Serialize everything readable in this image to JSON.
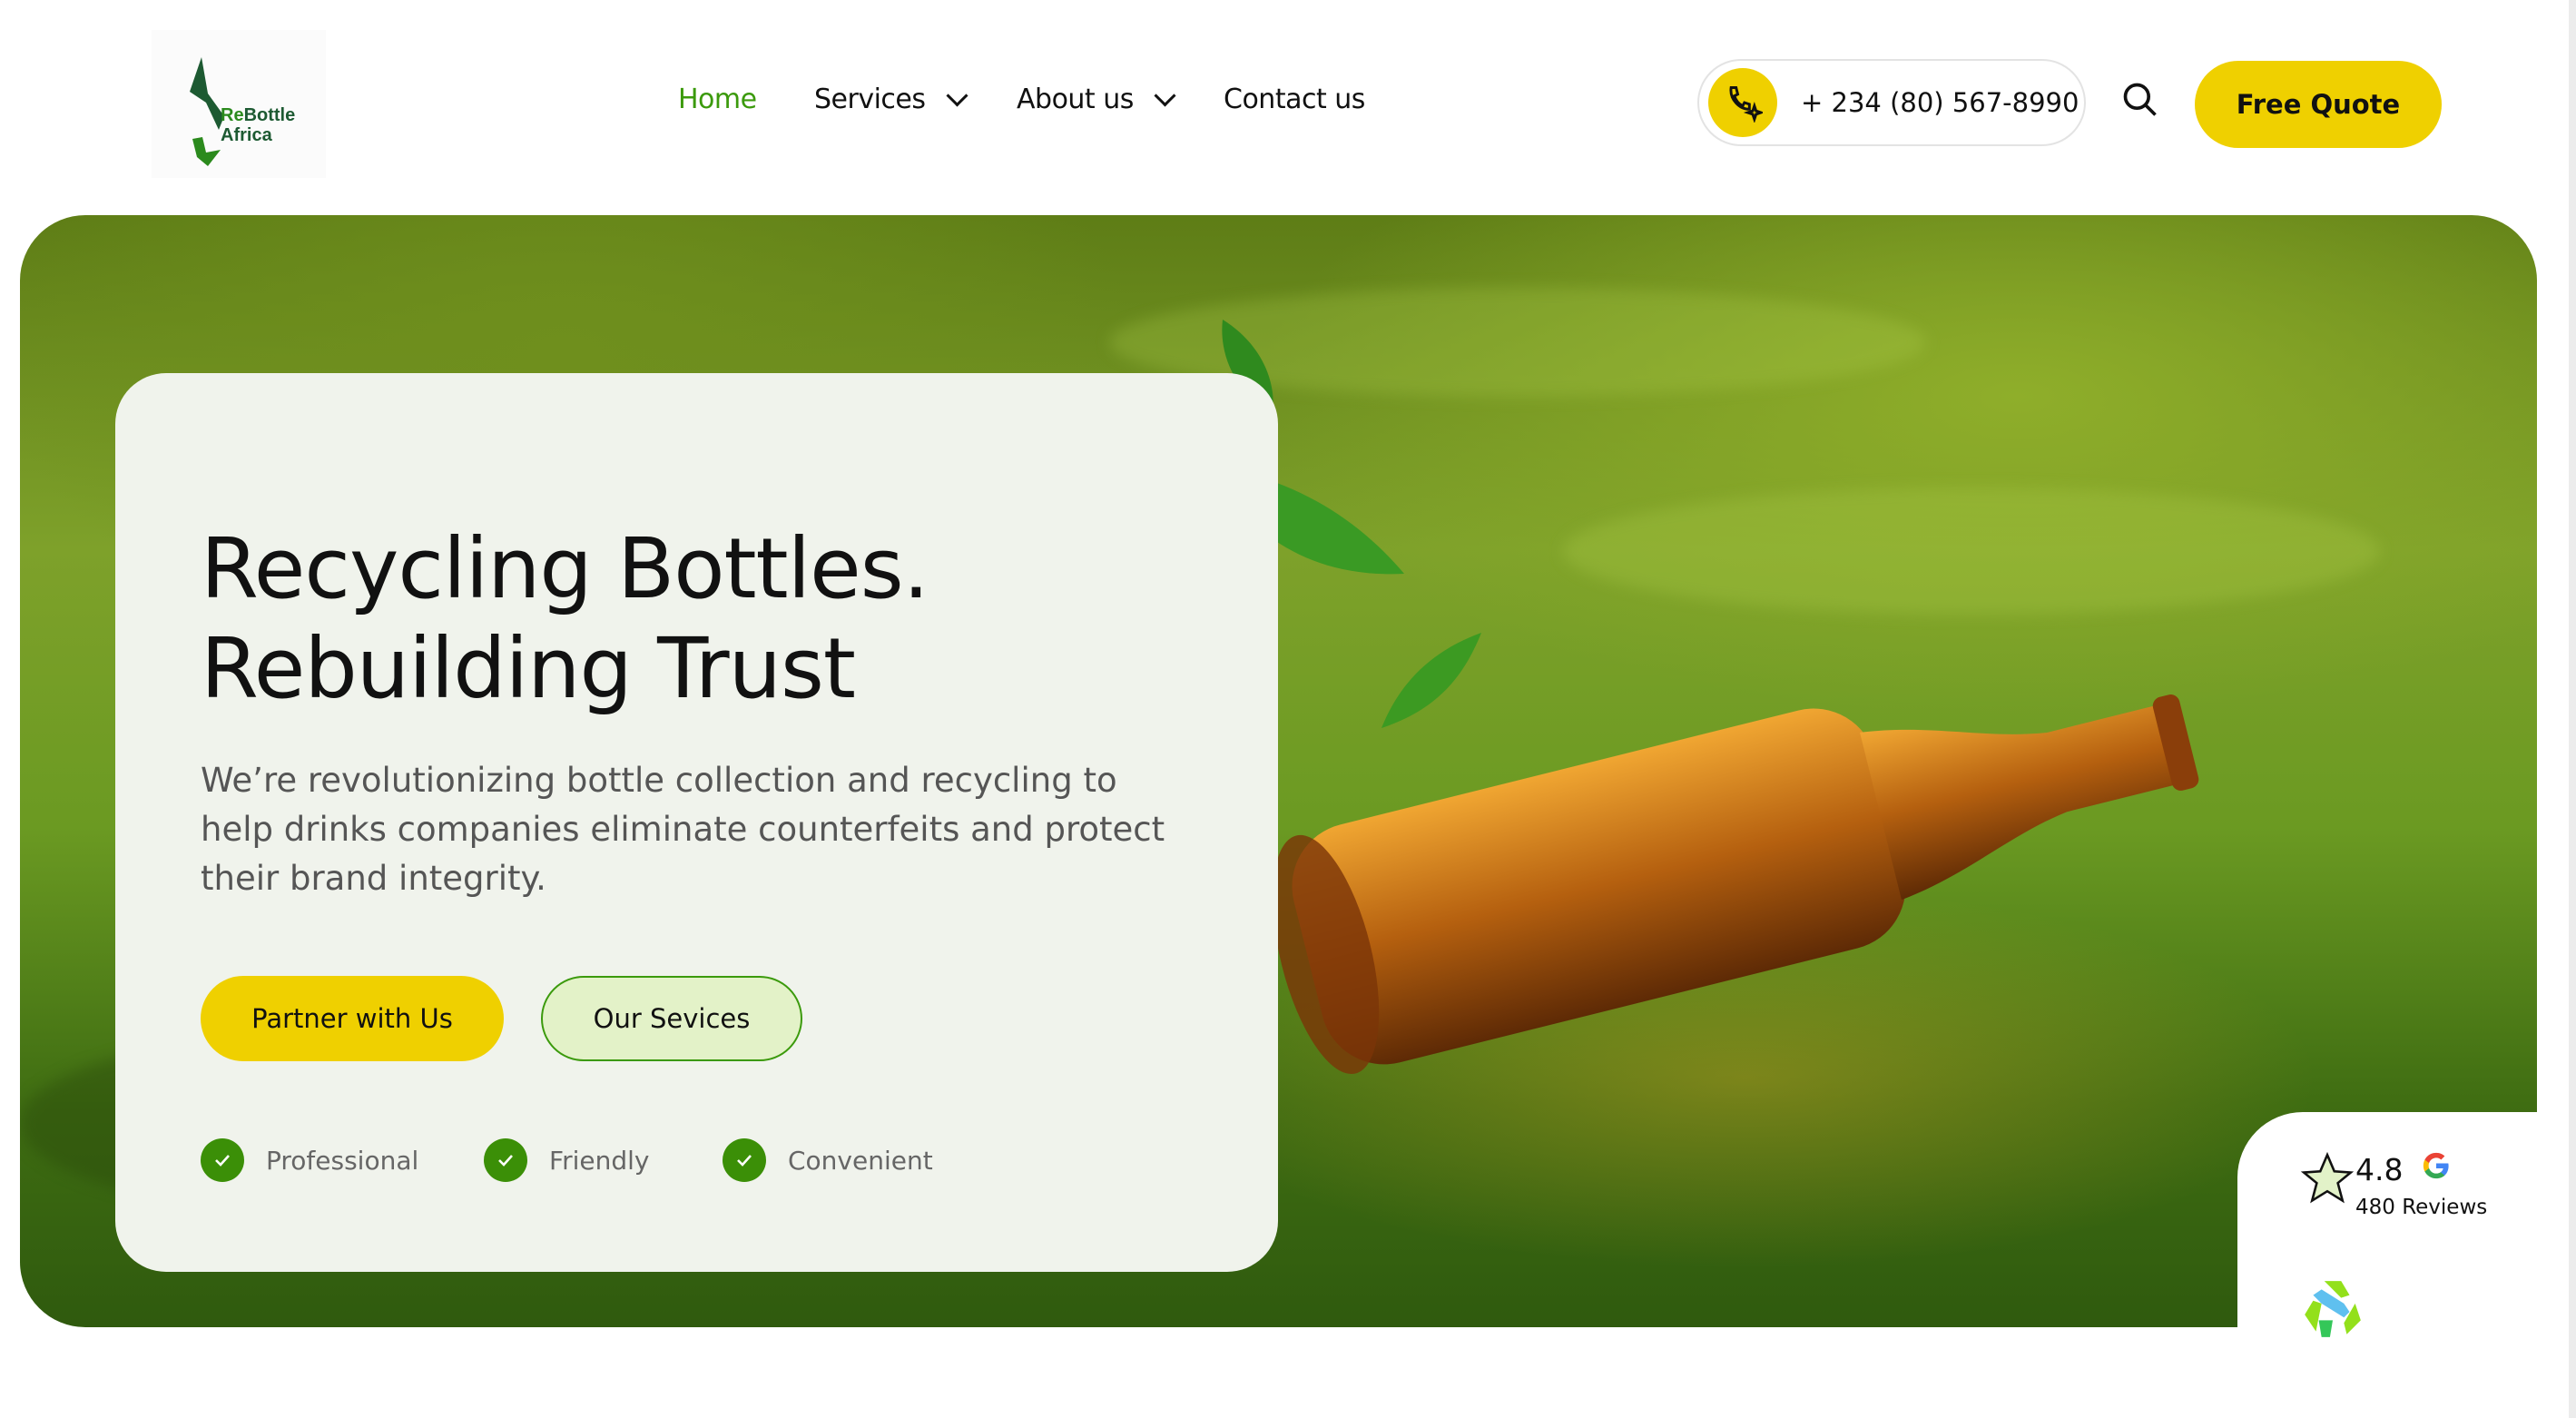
{
  "header": {
    "logo": {
      "line1": "ReBottle",
      "line2": "Africa"
    },
    "nav": [
      {
        "label": "Home",
        "active": true
      },
      {
        "label": "Services",
        "dropdown": true
      },
      {
        "label": "About us",
        "dropdown": true
      },
      {
        "label": "Contact us"
      }
    ],
    "phone": "+ 234 (80) 567-8990",
    "cta": "Free Quote"
  },
  "hero": {
    "title_line1": "Recycling Bottles.",
    "title_line2": "Rebuilding Trust",
    "description": "We’re revolutionizing bottle collection and recycling to help drinks companies eliminate counterfeits and protect their brand integrity.",
    "primary_button": "Partner with Us",
    "secondary_button": "Our Sevices",
    "features": [
      "Professional",
      "Friendly",
      "Convenient"
    ]
  },
  "rating": {
    "score": "4.8",
    "reviews": "480 Reviews"
  },
  "colors": {
    "accent": "#efd000",
    "brand_green": "#3b9a0c",
    "card_bg": "#f0f3ec"
  }
}
